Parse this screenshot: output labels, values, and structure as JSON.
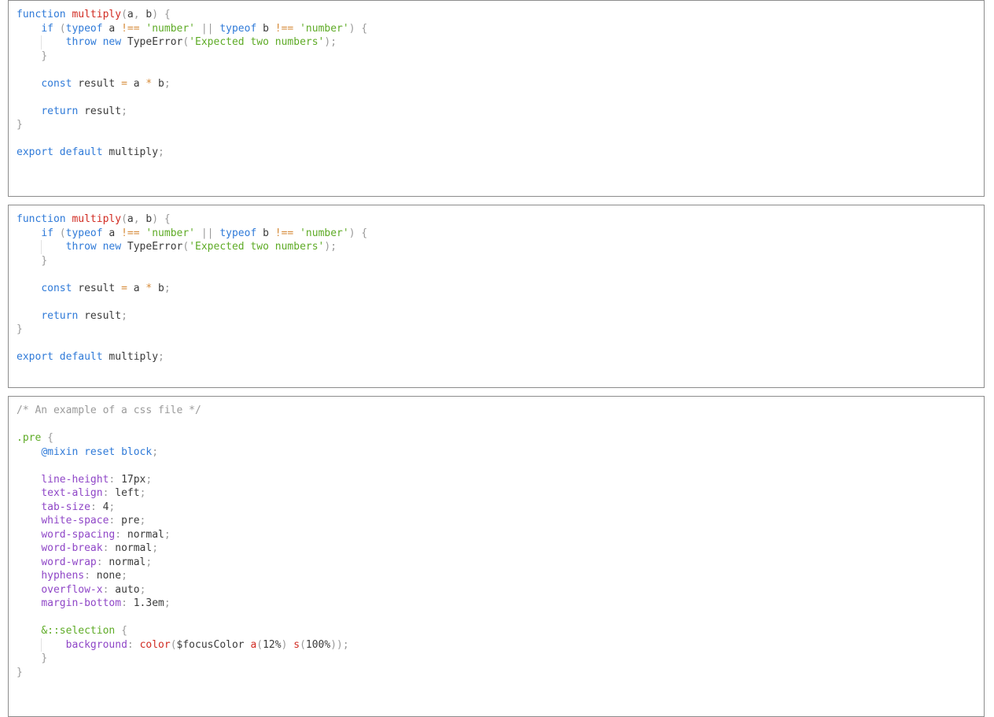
{
  "blocks": [
    {
      "name": "js-code-block-1",
      "top": 0,
      "lines": [
        [
          [
            "kw",
            "function"
          ],
          [
            "sp",
            " "
          ],
          [
            "fn",
            "multiply"
          ],
          [
            "pun",
            "("
          ],
          [
            "id",
            "a"
          ],
          [
            "pun",
            ","
          ],
          [
            "sp",
            " "
          ],
          [
            "id",
            "b"
          ],
          [
            "pun",
            ")"
          ],
          [
            "sp",
            " "
          ],
          [
            "pun",
            "{"
          ]
        ],
        [
          [
            "sp",
            "    "
          ],
          [
            "kw",
            "if"
          ],
          [
            "sp",
            " "
          ],
          [
            "pun",
            "("
          ],
          [
            "kw",
            "typeof"
          ],
          [
            "sp",
            " "
          ],
          [
            "id",
            "a"
          ],
          [
            "sp",
            " "
          ],
          [
            "op",
            "!=="
          ],
          [
            "sp",
            " "
          ],
          [
            "str",
            "'number'"
          ],
          [
            "sp",
            " "
          ],
          [
            "pun",
            "||"
          ],
          [
            "sp",
            " "
          ],
          [
            "kw",
            "typeof"
          ],
          [
            "sp",
            " "
          ],
          [
            "id",
            "b"
          ],
          [
            "sp",
            " "
          ],
          [
            "op",
            "!=="
          ],
          [
            "sp",
            " "
          ],
          [
            "str",
            "'number'"
          ],
          [
            "pun",
            ")"
          ],
          [
            "sp",
            " "
          ],
          [
            "pun",
            "{"
          ]
        ],
        [
          [
            "sp",
            "        "
          ],
          [
            "kw",
            "throw"
          ],
          [
            "sp",
            " "
          ],
          [
            "kw",
            "new"
          ],
          [
            "sp",
            " "
          ],
          [
            "id",
            "TypeError"
          ],
          [
            "pun",
            "("
          ],
          [
            "str",
            "'Expected two numbers'"
          ],
          [
            "pun",
            ")"
          ],
          [
            "pun",
            ";"
          ]
        ],
        [
          [
            "sp",
            "    "
          ],
          [
            "pun",
            "}"
          ]
        ],
        [],
        [
          [
            "sp",
            "    "
          ],
          [
            "kw",
            "const"
          ],
          [
            "sp",
            " "
          ],
          [
            "id",
            "result"
          ],
          [
            "sp",
            " "
          ],
          [
            "op",
            "="
          ],
          [
            "sp",
            " "
          ],
          [
            "id",
            "a"
          ],
          [
            "sp",
            " "
          ],
          [
            "op",
            "*"
          ],
          [
            "sp",
            " "
          ],
          [
            "id",
            "b"
          ],
          [
            "pun",
            ";"
          ]
        ],
        [],
        [
          [
            "sp",
            "    "
          ],
          [
            "kw",
            "return"
          ],
          [
            "sp",
            " "
          ],
          [
            "id",
            "result"
          ],
          [
            "pun",
            ";"
          ]
        ],
        [
          [
            "pun",
            "}"
          ]
        ],
        [],
        [
          [
            "kw",
            "export"
          ],
          [
            "sp",
            " "
          ],
          [
            "kw",
            "default"
          ],
          [
            "sp",
            " "
          ],
          [
            "id",
            "multiply"
          ],
          [
            "pun",
            ";"
          ]
        ]
      ]
    },
    {
      "name": "js-code-block-2",
      "lines": [
        [
          [
            "kw",
            "function"
          ],
          [
            "sp",
            " "
          ],
          [
            "fn",
            "multiply"
          ],
          [
            "pun",
            "("
          ],
          [
            "id",
            "a"
          ],
          [
            "pun",
            ","
          ],
          [
            "sp",
            " "
          ],
          [
            "id",
            "b"
          ],
          [
            "pun",
            ")"
          ],
          [
            "sp",
            " "
          ],
          [
            "pun",
            "{"
          ]
        ],
        [
          [
            "sp",
            "    "
          ],
          [
            "kw",
            "if"
          ],
          [
            "sp",
            " "
          ],
          [
            "pun",
            "("
          ],
          [
            "kw",
            "typeof"
          ],
          [
            "sp",
            " "
          ],
          [
            "id",
            "a"
          ],
          [
            "sp",
            " "
          ],
          [
            "op",
            "!=="
          ],
          [
            "sp",
            " "
          ],
          [
            "str",
            "'number'"
          ],
          [
            "sp",
            " "
          ],
          [
            "pun",
            "||"
          ],
          [
            "sp",
            " "
          ],
          [
            "kw",
            "typeof"
          ],
          [
            "sp",
            " "
          ],
          [
            "id",
            "b"
          ],
          [
            "sp",
            " "
          ],
          [
            "op",
            "!=="
          ],
          [
            "sp",
            " "
          ],
          [
            "str",
            "'number'"
          ],
          [
            "pun",
            ")"
          ],
          [
            "sp",
            " "
          ],
          [
            "pun",
            "{"
          ]
        ],
        [
          [
            "sp",
            "        "
          ],
          [
            "kw",
            "throw"
          ],
          [
            "sp",
            " "
          ],
          [
            "kw",
            "new"
          ],
          [
            "sp",
            " "
          ],
          [
            "id",
            "TypeError"
          ],
          [
            "pun",
            "("
          ],
          [
            "str",
            "'Expected two numbers'"
          ],
          [
            "pun",
            ")"
          ],
          [
            "pun",
            ";"
          ]
        ],
        [
          [
            "sp",
            "    "
          ],
          [
            "pun",
            "}"
          ]
        ],
        [],
        [
          [
            "sp",
            "    "
          ],
          [
            "kw",
            "const"
          ],
          [
            "sp",
            " "
          ],
          [
            "id",
            "result"
          ],
          [
            "sp",
            " "
          ],
          [
            "op",
            "="
          ],
          [
            "sp",
            " "
          ],
          [
            "id",
            "a"
          ],
          [
            "sp",
            " "
          ],
          [
            "op",
            "*"
          ],
          [
            "sp",
            " "
          ],
          [
            "id",
            "b"
          ],
          [
            "pun",
            ";"
          ]
        ],
        [],
        [
          [
            "sp",
            "    "
          ],
          [
            "kw",
            "return"
          ],
          [
            "sp",
            " "
          ],
          [
            "id",
            "result"
          ],
          [
            "pun",
            ";"
          ]
        ],
        [
          [
            "pun",
            "}"
          ]
        ],
        [],
        [
          [
            "kw",
            "export"
          ],
          [
            "sp",
            " "
          ],
          [
            "kw",
            "default"
          ],
          [
            "sp",
            " "
          ],
          [
            "id",
            "multiply"
          ],
          [
            "pun",
            ";"
          ]
        ]
      ]
    },
    {
      "name": "css-code-block",
      "lines": [
        [
          [
            "com",
            "/* An example of a css file */"
          ]
        ],
        [],
        [
          [
            "sel",
            ".pre"
          ],
          [
            "sp",
            " "
          ],
          [
            "pun",
            "{"
          ]
        ],
        [
          [
            "sp",
            "    "
          ],
          [
            "at",
            "@mixin"
          ],
          [
            "sp",
            " "
          ],
          [
            "at",
            "reset block"
          ],
          [
            "pun",
            ";"
          ]
        ],
        [],
        [
          [
            "sp",
            "    "
          ],
          [
            "prop",
            "line-height"
          ],
          [
            "pun",
            ":"
          ],
          [
            "sp",
            " "
          ],
          [
            "num",
            "17px"
          ],
          [
            "pun",
            ";"
          ]
        ],
        [
          [
            "sp",
            "    "
          ],
          [
            "prop",
            "text-align"
          ],
          [
            "pun",
            ":"
          ],
          [
            "sp",
            " "
          ],
          [
            "num",
            "left"
          ],
          [
            "pun",
            ";"
          ]
        ],
        [
          [
            "sp",
            "    "
          ],
          [
            "prop",
            "tab-size"
          ],
          [
            "pun",
            ":"
          ],
          [
            "sp",
            " "
          ],
          [
            "num",
            "4"
          ],
          [
            "pun",
            ";"
          ]
        ],
        [
          [
            "sp",
            "    "
          ],
          [
            "prop",
            "white-space"
          ],
          [
            "pun",
            ":"
          ],
          [
            "sp",
            " "
          ],
          [
            "num",
            "pre"
          ],
          [
            "pun",
            ";"
          ]
        ],
        [
          [
            "sp",
            "    "
          ],
          [
            "prop",
            "word-spacing"
          ],
          [
            "pun",
            ":"
          ],
          [
            "sp",
            " "
          ],
          [
            "num",
            "normal"
          ],
          [
            "pun",
            ";"
          ]
        ],
        [
          [
            "sp",
            "    "
          ],
          [
            "prop",
            "word-break"
          ],
          [
            "pun",
            ":"
          ],
          [
            "sp",
            " "
          ],
          [
            "num",
            "normal"
          ],
          [
            "pun",
            ";"
          ]
        ],
        [
          [
            "sp",
            "    "
          ],
          [
            "prop",
            "word-wrap"
          ],
          [
            "pun",
            ":"
          ],
          [
            "sp",
            " "
          ],
          [
            "num",
            "normal"
          ],
          [
            "pun",
            ";"
          ]
        ],
        [
          [
            "sp",
            "    "
          ],
          [
            "prop",
            "hyphens"
          ],
          [
            "pun",
            ":"
          ],
          [
            "sp",
            " "
          ],
          [
            "num",
            "none"
          ],
          [
            "pun",
            ";"
          ]
        ],
        [
          [
            "sp",
            "    "
          ],
          [
            "prop",
            "overflow-x"
          ],
          [
            "pun",
            ":"
          ],
          [
            "sp",
            " "
          ],
          [
            "num",
            "auto"
          ],
          [
            "pun",
            ";"
          ]
        ],
        [
          [
            "sp",
            "    "
          ],
          [
            "prop",
            "margin-bottom"
          ],
          [
            "pun",
            ":"
          ],
          [
            "sp",
            " "
          ],
          [
            "num",
            "1.3em"
          ],
          [
            "pun",
            ";"
          ]
        ],
        [],
        [
          [
            "sp",
            "    "
          ],
          [
            "sel",
            "&::selection"
          ],
          [
            "sp",
            " "
          ],
          [
            "pun",
            "{"
          ]
        ],
        [
          [
            "sp",
            "        "
          ],
          [
            "prop",
            "background"
          ],
          [
            "pun",
            ":"
          ],
          [
            "sp",
            " "
          ],
          [
            "fn",
            "color"
          ],
          [
            "pun",
            "("
          ],
          [
            "id",
            "$focusColor"
          ],
          [
            "sp",
            " "
          ],
          [
            "fn",
            "a"
          ],
          [
            "pun",
            "("
          ],
          [
            "num",
            "12%"
          ],
          [
            "pun",
            ")"
          ],
          [
            "sp",
            " "
          ],
          [
            "fn",
            "s"
          ],
          [
            "pun",
            "("
          ],
          [
            "num",
            "100%"
          ],
          [
            "pun",
            ")"
          ],
          [
            "pun",
            ")"
          ],
          [
            "pun",
            ";"
          ]
        ],
        [
          [
            "sp",
            "    "
          ],
          [
            "pun",
            "}"
          ]
        ],
        [
          [
            "pun",
            "}"
          ]
        ]
      ]
    }
  ],
  "colors": {
    "keyword": "#2f7ad8",
    "function_name": "#d12b22",
    "string": "#5eab26",
    "property": "#8f46c7",
    "punctuation": "#9a9a9a",
    "operator": "#d68b3a",
    "text": "#3a3a3a",
    "border": "#8c8c8c"
  }
}
